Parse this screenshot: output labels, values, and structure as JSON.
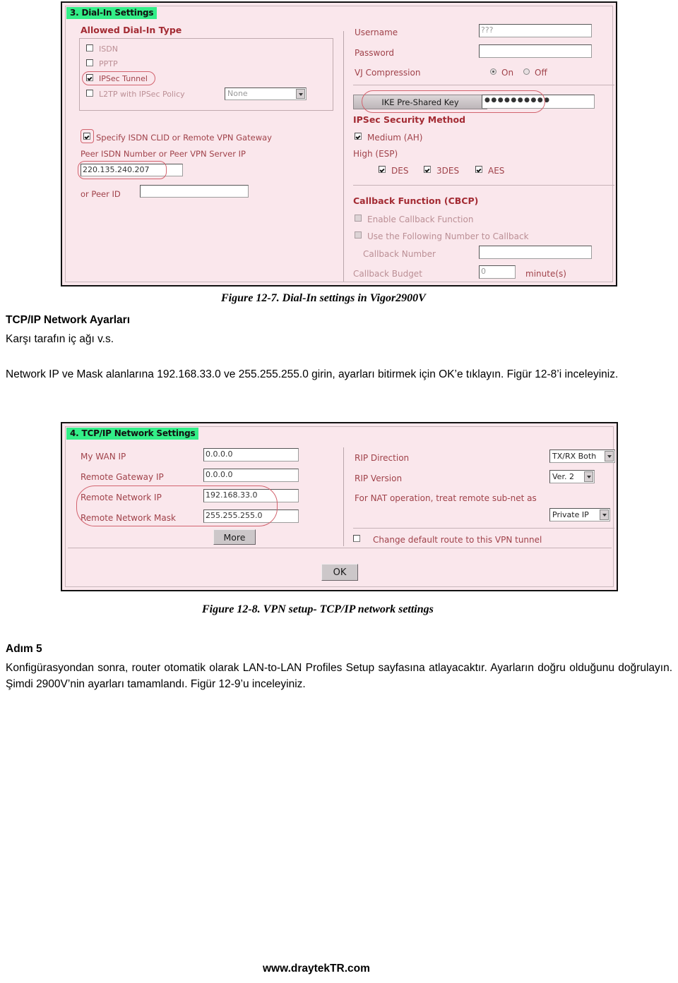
{
  "figure1": {
    "section_title": "3. Dial-In Settings",
    "left": {
      "group_heading": "Allowed Dial-In Type",
      "options": [
        {
          "label": "ISDN",
          "checked": false
        },
        {
          "label": "PPTP",
          "checked": false
        },
        {
          "label": "IPSec Tunnel",
          "checked": true
        },
        {
          "label": "L2TP with IPSec Policy",
          "checked": false
        }
      ],
      "l2tp_policy_value": "None",
      "specify_gateway_label": "Specify ISDN CLID or Remote VPN Gateway",
      "specify_gateway_checked": true,
      "peer_isdn_label": "Peer ISDN Number or Peer VPN Server IP",
      "peer_isdn_value": "220.135.240.207",
      "peer_id_label": "or Peer ID",
      "peer_id_value": ""
    },
    "right": {
      "username_label": "Username",
      "username_value": "???",
      "password_label": "Password",
      "password_value": "",
      "vj_label": "VJ Compression",
      "vj_on": "On",
      "vj_off": "Off",
      "vj_selected": "On",
      "ike_button": "IKE Pre-Shared Key",
      "ike_value_dots": "●●●●●●●●●●",
      "ipsec_heading": "IPSec Security Method",
      "medium_label": "Medium (AH)",
      "medium_checked": true,
      "high_label": "High (ESP)",
      "esp_options": [
        {
          "label": "DES",
          "checked": true
        },
        {
          "label": "3DES",
          "checked": true
        },
        {
          "label": "AES",
          "checked": true
        }
      ],
      "callback_heading": "Callback Function (CBCP)",
      "enable_callback_label": "Enable Callback Function",
      "enable_callback_checked": false,
      "use_number_label": "Use the Following Number to Callback",
      "use_number_checked": false,
      "callback_number_label": "Callback Number",
      "callback_number_value": "",
      "callback_budget_label": "Callback Budget",
      "callback_budget_value": "0",
      "minutes_label": "minute(s)"
    },
    "caption": "Figure 12-7. Dial-In settings in Vigor2900V"
  },
  "doc": {
    "heading1": "TCP/IP Network Ayarları",
    "sub1": "Karşı tarafın iç ağı v.s.",
    "para1": "Network IP ve Mask alanlarına 192.168.33.0 ve 255.255.255.0 girin, ayarları bitirmek için OK’e tıklayın. Figür 12-8’i inceleyiniz.",
    "heading2": "Adım 5",
    "para2": "Konfigürasyondan sonra, router otomatik olarak LAN-to-LAN Profiles Setup sayfasına atlayacaktır. Ayarların doğru olduğunu doğrulayın. Şimdi 2900V’nin ayarları tamamlandı. Figür 12-9’u inceleyiniz."
  },
  "figure2": {
    "section_title": "4. TCP/IP Network Settings",
    "left": {
      "rows": [
        {
          "label": "My WAN IP",
          "value": "0.0.0.0"
        },
        {
          "label": "Remote Gateway IP",
          "value": "0.0.0.0"
        },
        {
          "label": "Remote Network IP",
          "value": "192.168.33.0"
        },
        {
          "label": "Remote Network Mask",
          "value": "255.255.255.0"
        }
      ],
      "more_button": "More"
    },
    "right": {
      "rip_direction_label": "RIP Direction",
      "rip_direction_value": "TX/RX Both",
      "rip_version_label": "RIP Version",
      "rip_version_value": "Ver. 2",
      "nat_label": "For NAT operation, treat remote sub-net as",
      "nat_value": "Private IP",
      "change_route_label": "Change default route to this VPN tunnel",
      "change_route_checked": false
    },
    "ok_button": "OK",
    "caption": "Figure 12-8. VPN setup- TCP/IP network settings"
  },
  "footer": "www.draytekTR.com"
}
